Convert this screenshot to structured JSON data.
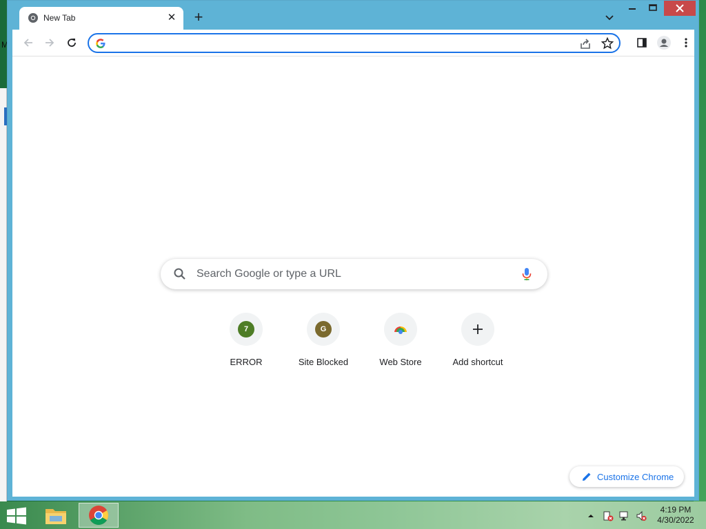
{
  "desktop": {
    "letter": "M"
  },
  "tab": {
    "title": "New Tab"
  },
  "omnibox": {
    "value": "",
    "placeholder": ""
  },
  "ntp": {
    "search_placeholder": "Search Google or type a URL",
    "shortcuts": [
      {
        "label": "ERROR",
        "badge": "7",
        "badge_color": "#4e7d26"
      },
      {
        "label": "Site Blocked",
        "badge": "G",
        "badge_color": "#7b6a2e"
      },
      {
        "label": "Web Store",
        "badge": "",
        "badge_color": ""
      },
      {
        "label": "Add shortcut",
        "badge": "+",
        "badge_color": ""
      }
    ],
    "customize_label": "Customize Chrome"
  },
  "colors": {
    "accent": "#1a73e8",
    "titlebar": "#5eb3d6",
    "close": "#c8494a"
  },
  "taskbar": {
    "apps": [
      "file-explorer",
      "google-chrome"
    ],
    "clock": {
      "time": "4:19 PM",
      "date": "4/30/2022"
    }
  }
}
